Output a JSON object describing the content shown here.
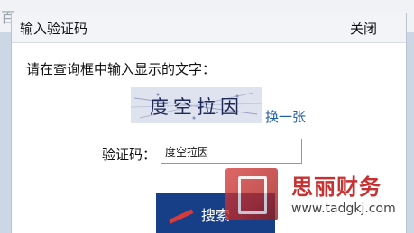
{
  "background": {
    "page_text": "百"
  },
  "dialog": {
    "title": "输入验证码",
    "close_label": "关闭",
    "prompt": "请在查询框中输入显示的文字：",
    "captcha_text": "度空拉因",
    "refresh_label": "换一张",
    "code_label": "验证码：",
    "code_value": "度空拉因",
    "search_label": "搜索"
  },
  "watermark": {
    "name": "思丽财务",
    "url": "www.tadgkj.com"
  },
  "colors": {
    "header_bg": "#f2f4f7",
    "button_bg": "#173f88",
    "link": "#1f5fa8",
    "watermark_red": "#c22020"
  }
}
